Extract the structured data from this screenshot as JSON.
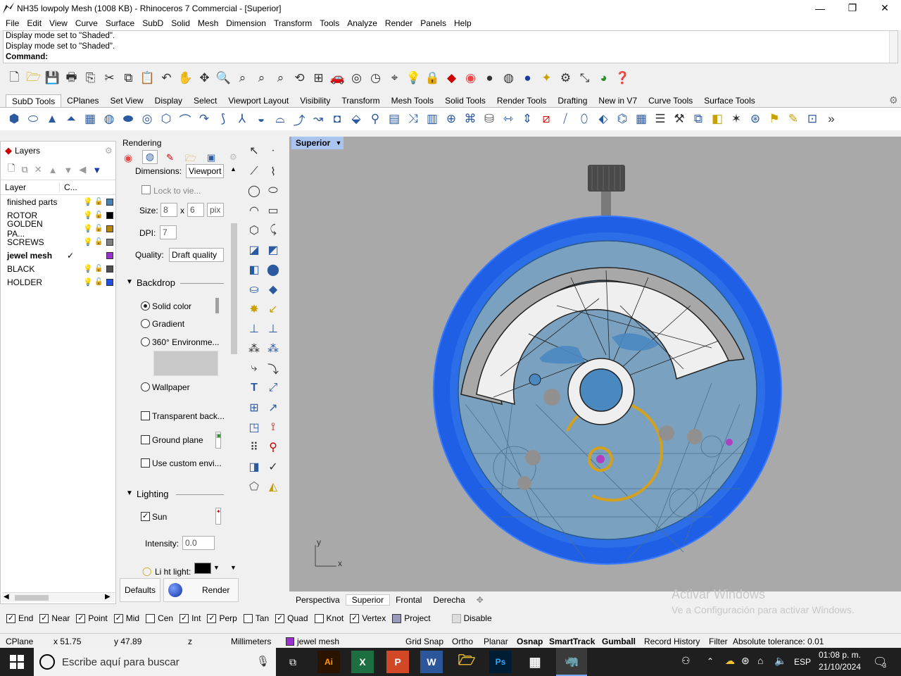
{
  "window": {
    "title": "NH35 lowpoly Mesh (1008 KB) - Rhinoceros 7 Commercial - [Superior]",
    "controls": [
      "—",
      "❐",
      "✕"
    ]
  },
  "menu": [
    "File",
    "Edit",
    "View",
    "Curve",
    "Surface",
    "SubD",
    "Solid",
    "Mesh",
    "Dimension",
    "Transform",
    "Tools",
    "Analyze",
    "Render",
    "Panels",
    "Help"
  ],
  "command": {
    "history": [
      "Display mode set to \"Shaded\".",
      "Display mode set to \"Shaded\"."
    ],
    "prompt": "Command:"
  },
  "tabs": [
    "SubD Tools",
    "CPlanes",
    "Set View",
    "Display",
    "Select",
    "Viewport Layout",
    "Visibility",
    "Transform",
    "Mesh Tools",
    "Solid Tools",
    "Render Tools",
    "Drafting",
    "New in V7",
    "Curve Tools",
    "Surface Tools"
  ],
  "layers": {
    "title": "Layers",
    "col_layer": "Layer",
    "col_c": "C...",
    "items": [
      {
        "name": "finished parts",
        "color": "#4682b4",
        "current": false
      },
      {
        "name": "ROTOR",
        "color": "#000000",
        "current": false
      },
      {
        "name": "GOLDEN PA...",
        "color": "#b8860b",
        "current": false
      },
      {
        "name": "SCREWS",
        "color": "#808080",
        "current": false
      },
      {
        "name": "jewel mesh",
        "color": "#9932cc",
        "current": true
      },
      {
        "name": "BLACK",
        "color": "#505050",
        "current": false
      },
      {
        "name": "HOLDER",
        "color": "#1e50e6",
        "current": false
      }
    ],
    "check": "✓"
  },
  "rendering": {
    "title": "Rendering",
    "dimensions_label": "Dimensions:",
    "dimensions_value": "Viewport",
    "lock_label": "Lock to vie...",
    "size_label": "Size:",
    "size_w": "8",
    "size_x": "x",
    "size_h": "6",
    "size_unit": "pix",
    "dpi_label": "DPI:",
    "dpi_value": "7",
    "quality_label": "Quality:",
    "quality_value": "Draft quality",
    "backdrop": "Backdrop",
    "solid_color": "Solid color",
    "gradient": "Gradient",
    "env360": "360° Environme...",
    "wallpaper": "Wallpaper",
    "transparent": "Transparent back...",
    "ground": "Ground plane",
    "custom_env": "Use custom envi...",
    "lighting": "Lighting",
    "sun": "Sun",
    "intensity_label": "Intensity:",
    "intensity_value": "0.0",
    "light_label": "Li ht light:",
    "defaults_btn": "Defaults",
    "render_btn": "Render"
  },
  "viewport": {
    "label": "Superior",
    "axis_y": "y",
    "axis_x": "x",
    "tabs": [
      "Perspectiva",
      "Superior",
      "Frontal",
      "Derecha"
    ],
    "active_tab": "Superior",
    "watermark1": "Activar Windows",
    "watermark2": "Ve a Configuración para activar Windows."
  },
  "osnap": {
    "items": [
      {
        "label": "End",
        "on": true
      },
      {
        "label": "Near",
        "on": true
      },
      {
        "label": "Point",
        "on": true
      },
      {
        "label": "Mid",
        "on": true
      },
      {
        "label": "Cen",
        "on": false
      },
      {
        "label": "Int",
        "on": true
      },
      {
        "label": "Perp",
        "on": true
      },
      {
        "label": "Tan",
        "on": false
      },
      {
        "label": "Quad",
        "on": true
      },
      {
        "label": "Knot",
        "on": false
      },
      {
        "label": "Vertex",
        "on": true
      },
      {
        "label": "Project",
        "on": false
      },
      {
        "label": "Disable",
        "on": false
      }
    ]
  },
  "status": {
    "cplane": "CPlane",
    "x": "x 51.75",
    "y": "y 47.89",
    "z": "z",
    "units": "Millimeters",
    "layer": "jewel mesh",
    "grid_snap": "Grid Snap",
    "ortho": "Ortho",
    "planar": "Planar",
    "osnap": "Osnap",
    "smarttrack": "SmartTrack",
    "gumball": "Gumball",
    "record": "Record History",
    "filter": "Filter",
    "tolerance": "Absolute tolerance: 0.01"
  },
  "taskbar": {
    "search": "Escribe aquí para buscar",
    "lang": "ESP",
    "time": "01:08 p. m.",
    "date": "21/10/2024",
    "notif": "3"
  }
}
